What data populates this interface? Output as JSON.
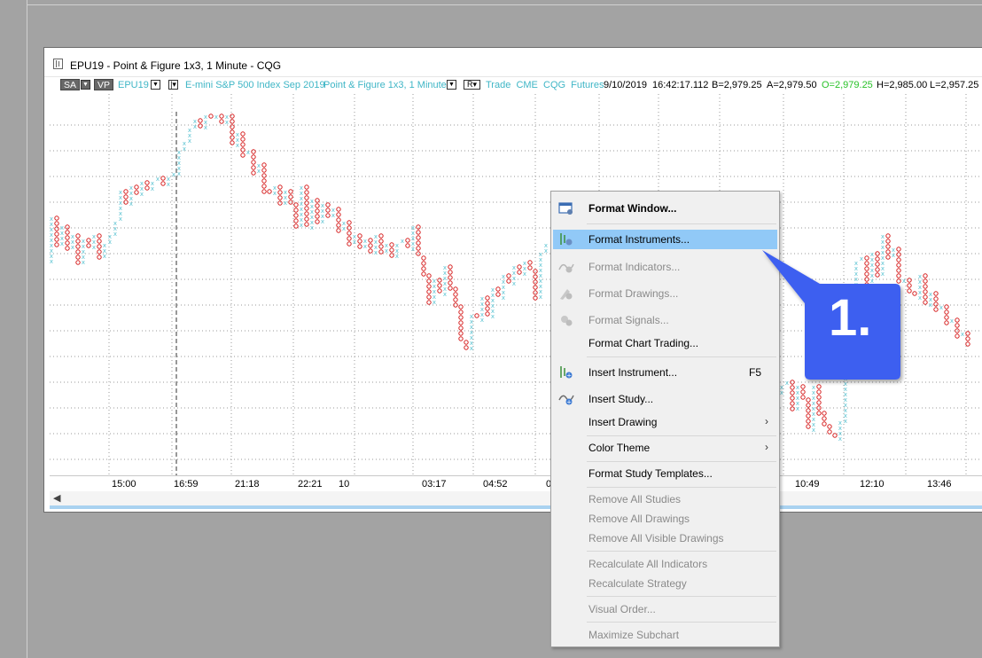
{
  "window": {
    "title": "EPU19 - Point & Figure 1x3, 1 Minute - CQG"
  },
  "infobar": {
    "sa_label": "SA",
    "vp_label": "VP",
    "symbol": "EPU19",
    "instrument_desc": "E-mini S&P 500 Index Sep 2019",
    "chart_desc": "Point & Figure 1x3, 1 Minute",
    "r_label": "R",
    "source": "Trade  CME  CQG  Futures",
    "date": "9/10/2019",
    "time": "16:42:17.112",
    "bid": "B=2,979.25",
    "ask": "A=2,979.50",
    "open": "O=2,979.25",
    "high": "H=2,985.00",
    "low": "L=2,957.25",
    "colors": {
      "cyan": "#3fb6c6",
      "open_green": "#29c229",
      "x_color": "#5bc3d2",
      "o_color": "#d62020"
    }
  },
  "xaxis": {
    "labels": [
      "15:00",
      "16:59",
      "21:18",
      "22:21",
      "10",
      "03:17",
      "04:52",
      "0",
      "10:49",
      "12:10",
      "13:46"
    ]
  },
  "menu": {
    "items": [
      {
        "label": "Format Window...",
        "icon": "format-window-icon",
        "bold": true
      },
      {
        "label": "Format Instruments...",
        "icon": "format-instruments-icon",
        "highlighted": true
      },
      {
        "label": "Format Indicators...",
        "icon": "format-indicators-icon",
        "disabled": true
      },
      {
        "label": "Format Drawings...",
        "icon": "format-drawings-icon",
        "disabled": true
      },
      {
        "label": "Format Signals...",
        "icon": "format-signals-icon",
        "disabled": true
      },
      {
        "label": "Format Chart Trading..."
      },
      {
        "label": "Insert Instrument...",
        "icon": "insert-instrument-icon",
        "shortcut": "F5"
      },
      {
        "label": "Insert Study...",
        "icon": "insert-study-icon"
      },
      {
        "label": "Insert Drawing",
        "submenu": true
      },
      {
        "label": "Color Theme",
        "submenu": true
      },
      {
        "label": "Format Study Templates..."
      },
      {
        "label": "Remove All Studies",
        "disabled": true
      },
      {
        "label": "Remove All Drawings",
        "disabled": true
      },
      {
        "label": "Remove All Visible Drawings",
        "disabled": true
      },
      {
        "label": "Recalculate All Indicators",
        "disabled": true
      },
      {
        "label": "Recalculate Strategy",
        "disabled": true
      },
      {
        "label": "Visual Order...",
        "disabled": true
      },
      {
        "label": "Maximize Subchart",
        "disabled": true
      }
    ]
  },
  "callout": {
    "text": "1.",
    "color": "#3d5ef0"
  }
}
